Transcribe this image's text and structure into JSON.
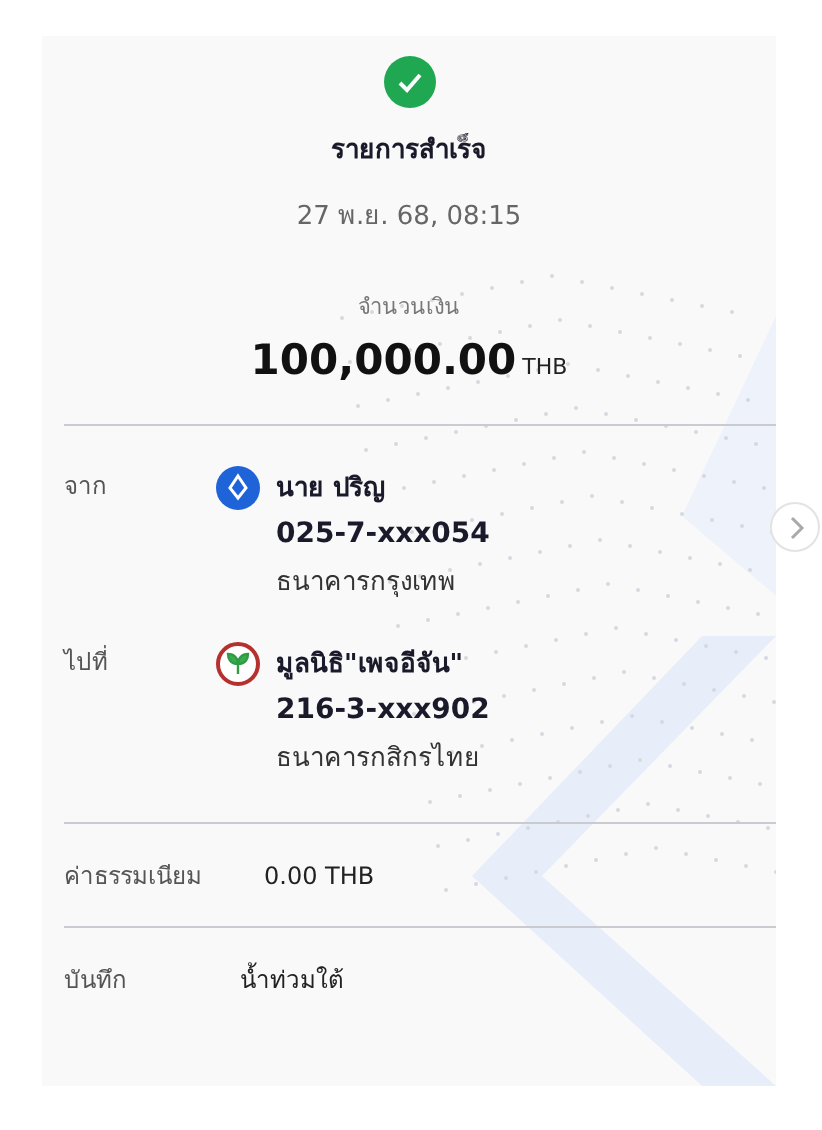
{
  "status": {
    "title": "รายการสำเร็จ",
    "datetime": "27 พ.ย. 68, 08:15"
  },
  "amount": {
    "label": "จำนวนเงิน",
    "value": "100,000.00",
    "currency": "THB"
  },
  "parties": [
    {
      "label": "จาก",
      "kind": "blue-lotus",
      "name": "นาย ปริญ",
      "account": "025-7-xxx054",
      "bank": "ธนาคารกรุงเทพ"
    },
    {
      "label": "ไปที่",
      "kind": "green-sprout",
      "name": "มูลนิธิ\"เพจอีจัน\"",
      "account": "216-3-xxx902",
      "bank": "ธนาคารกสิกรไทย"
    }
  ],
  "fee": {
    "label": "ค่าธรรมเนียม",
    "value": "0.00 THB"
  },
  "note": {
    "label": "บันทึก",
    "value": "น้ำท่วมใต้"
  }
}
